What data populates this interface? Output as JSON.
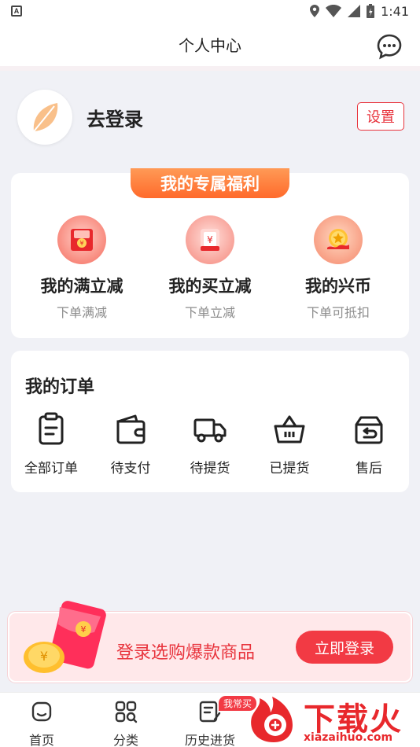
{
  "status_bar": {
    "time": "1:41",
    "left_badge": "A"
  },
  "header": {
    "title": "个人中心"
  },
  "profile": {
    "login_text": "去登录",
    "settings_label": "设置"
  },
  "benefits": {
    "title": "我的专属福利",
    "items": [
      {
        "name": "我的满立减",
        "desc": "下单满减"
      },
      {
        "name": "我的买立减",
        "desc": "下单立减"
      },
      {
        "name": "我的兴币",
        "desc": "下单可抵扣"
      }
    ]
  },
  "orders": {
    "title": "我的订单",
    "items": [
      {
        "label": "全部订单"
      },
      {
        "label": "待支付"
      },
      {
        "label": "待提货"
      },
      {
        "label": "已提货"
      },
      {
        "label": "售后"
      }
    ]
  },
  "login_banner": {
    "text": "登录选购爆款商品",
    "button": "立即登录"
  },
  "tabbar": {
    "items": [
      {
        "label": "首页"
      },
      {
        "label": "分类"
      },
      {
        "label": "历史进货"
      }
    ],
    "badge": "我常买"
  },
  "watermark": {
    "big": "下载火",
    "small": "xiazaihuo.com"
  },
  "colors": {
    "accent": "#e8333c",
    "ribbon": "#ff7a3a",
    "background": "#f0f1f6"
  }
}
